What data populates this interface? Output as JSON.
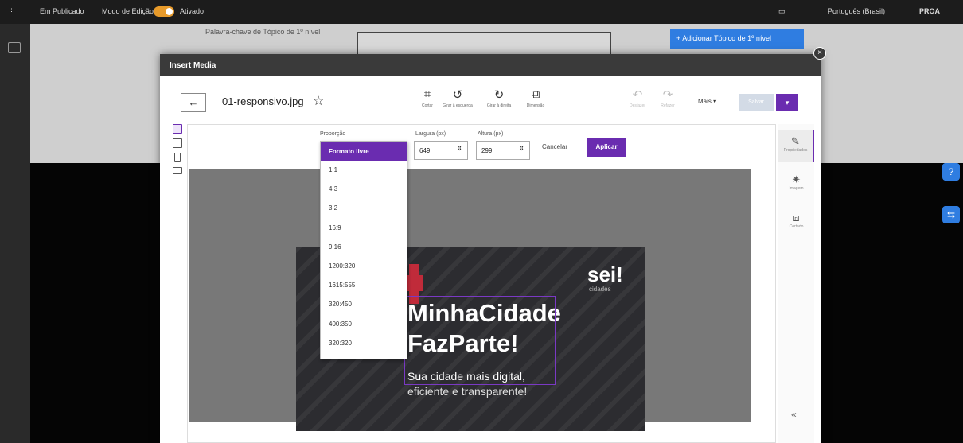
{
  "topbar": {
    "status": "Em Publicado",
    "mode": "Modo de Edição",
    "toggle_state": "Ativado",
    "language": "Português (Brasil)",
    "brand": "PROA"
  },
  "background": {
    "field_label": "Palavra-chave de Tópico de 1º nível",
    "add_button": "+ Adicionar Tópico de 1º nível"
  },
  "modal": {
    "title": "Insert Media",
    "close_icon": "close-icon"
  },
  "editor": {
    "filename": "01-responsivo.jpg",
    "toolbar": [
      {
        "icon": "crop-icon",
        "glyph": "⌗",
        "label": "Cortar",
        "disabled": false
      },
      {
        "icon": "rotate-left-icon",
        "glyph": "↺",
        "label": "Girar à esquerda",
        "disabled": false
      },
      {
        "icon": "rotate-right-icon",
        "glyph": "↻",
        "label": "Girar à direita",
        "disabled": false
      },
      {
        "icon": "resize-icon",
        "glyph": "⧉",
        "label": "Dimensão",
        "disabled": false
      },
      {
        "icon": "undo-icon",
        "glyph": "↶",
        "label": "Desfazer",
        "disabled": true
      },
      {
        "icon": "redo-icon",
        "glyph": "↷",
        "label": "Refazer",
        "disabled": true
      }
    ],
    "more_label": "Mais ▾",
    "save_label": "Salvar",
    "save_dropdown": "▾"
  },
  "crop": {
    "ratio_label": "Proporção",
    "width_label": "Largura (px)",
    "width_value": "649",
    "height_label": "Altura (px)",
    "height_value": "299",
    "cancel": "Cancelar",
    "apply": "Aplicar",
    "selected_ratio": "Formato livre",
    "ratios": [
      "1:1",
      "4:3",
      "3:2",
      "16:9",
      "9:16",
      "1200:320",
      "1615:555",
      "320:450",
      "400:350",
      "320:320"
    ]
  },
  "banner": {
    "logo": "sei!",
    "logo_sub": "cidades",
    "headline_1": "MinhaCidade",
    "headline_2": "FazParte!",
    "line_1": "Sua cidade mais digital,",
    "line_2": "eficiente e transparente!"
  },
  "right_panel": [
    {
      "icon": "adjust-icon",
      "glyph": "✎",
      "label": "Propriedades",
      "active": true
    },
    {
      "icon": "sun-icon",
      "glyph": "✷",
      "label": "Imagem",
      "active": false
    },
    {
      "icon": "crop-icon",
      "glyph": "⧈",
      "label": "Cortado",
      "active": false
    }
  ],
  "collapse": "«"
}
